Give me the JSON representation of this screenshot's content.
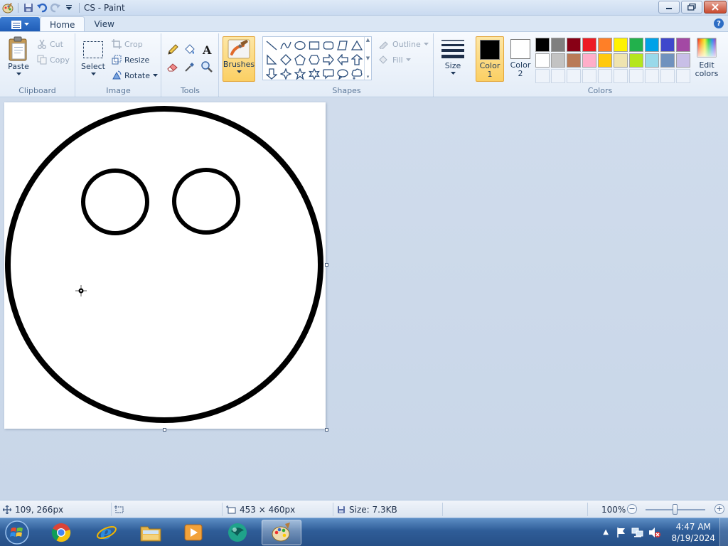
{
  "window": {
    "title": "CS - Paint"
  },
  "tabs": [
    {
      "label": "Home"
    },
    {
      "label": "View"
    }
  ],
  "ribbon": {
    "clipboard": {
      "paste": "Paste",
      "cut": "Cut",
      "copy": "Copy",
      "label": "Clipboard"
    },
    "image": {
      "select": "Select",
      "crop": "Crop",
      "resize": "Resize",
      "rotate": "Rotate",
      "label": "Image"
    },
    "tools": {
      "label": "Tools"
    },
    "brushes": {
      "label": "Brushes"
    },
    "shapes": {
      "outline": "Outline",
      "fill": "Fill",
      "label": "Shapes"
    },
    "size": {
      "label": "Size"
    },
    "color1": {
      "line1": "Color",
      "line2": "1",
      "value": "#000000"
    },
    "color2": {
      "line1": "Color",
      "line2": "2",
      "value": "#ffffff"
    },
    "colors": {
      "label": "Colors",
      "edit_line1": "Edit",
      "edit_line2": "colors"
    },
    "palette_row1": [
      "#000000",
      "#7f7f7f",
      "#880015",
      "#ed1c24",
      "#ff7f27",
      "#fff200",
      "#22b14c",
      "#00a2e8",
      "#3f48cc",
      "#a349a4"
    ],
    "palette_row2": [
      "#ffffff",
      "#c3c3c3",
      "#b97a57",
      "#ffaec9",
      "#ffc90e",
      "#efe4b0",
      "#b5e61d",
      "#99d9ea",
      "#7092be",
      "#c8bfe7"
    ]
  },
  "status": {
    "cursor_pos": "109, 266px",
    "canvas_size": "453 × 460px",
    "file_size": "Size: 7.3KB",
    "zoom": "100%",
    "zoom_fraction": 0.5
  },
  "taskbar": {
    "time": "4:47 AM",
    "date": "8/19/2024"
  }
}
